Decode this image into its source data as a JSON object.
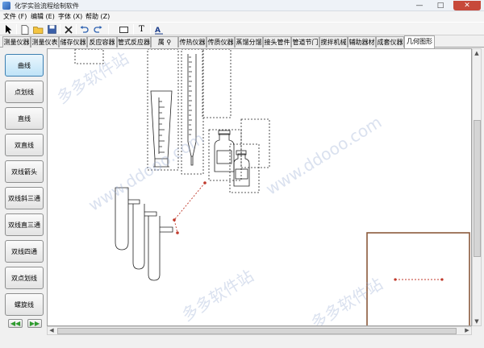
{
  "window": {
    "title": "化学实验流程绘制软件",
    "minimize_glyph": "—",
    "maximize_glyph": "□",
    "close_glyph": "✕"
  },
  "menu": [
    {
      "label": "文件 (F)"
    },
    {
      "label": "编辑 (E)"
    },
    {
      "label": "字体 (X)"
    },
    {
      "label": "帮助 (Z)"
    }
  ],
  "toolbar": {
    "icons": [
      "pointer-icon",
      "new-file-icon",
      "open-folder-icon",
      "save-icon",
      "delete-icon",
      "undo-icon",
      "redo-icon",
      "rectangle-icon",
      "text-icon",
      "font-icon"
    ],
    "text_tool_glyph": "T"
  },
  "tabs": [
    {
      "label": "测量仪器"
    },
    {
      "label": "测量仪表"
    },
    {
      "label": "储存仪器"
    },
    {
      "label": "反应容器"
    },
    {
      "label": "管式反应器"
    },
    {
      "label": "属 ⚲"
    },
    {
      "label": "传热仪器"
    },
    {
      "label": "传质仪器"
    },
    {
      "label": "蒸馏分馏"
    },
    {
      "label": "接头管件"
    },
    {
      "label": "管道节门"
    },
    {
      "label": "搅拌机械"
    },
    {
      "label": "辅助器材"
    },
    {
      "label": "成套仪器"
    },
    {
      "label": "几何图形",
      "active": true
    }
  ],
  "shape_buttons": [
    {
      "label": "曲线",
      "active": true
    },
    {
      "label": "点划线"
    },
    {
      "label": "直线"
    },
    {
      "label": "双直线"
    },
    {
      "label": "双线箭头"
    },
    {
      "label": "双线斜三通"
    },
    {
      "label": "双线直三通"
    },
    {
      "label": "双线四通"
    },
    {
      "label": "双点划线"
    },
    {
      "label": "螺旋线"
    }
  ],
  "nav": {
    "prev": "◀◀",
    "next": "▶▶"
  },
  "watermark_text": "多多软件站",
  "watermark_url": "www.ddooo.com",
  "colors": {
    "accent": "#3c7fb1",
    "connector": "#c0392b",
    "preview_border": "#8b5a3c"
  }
}
